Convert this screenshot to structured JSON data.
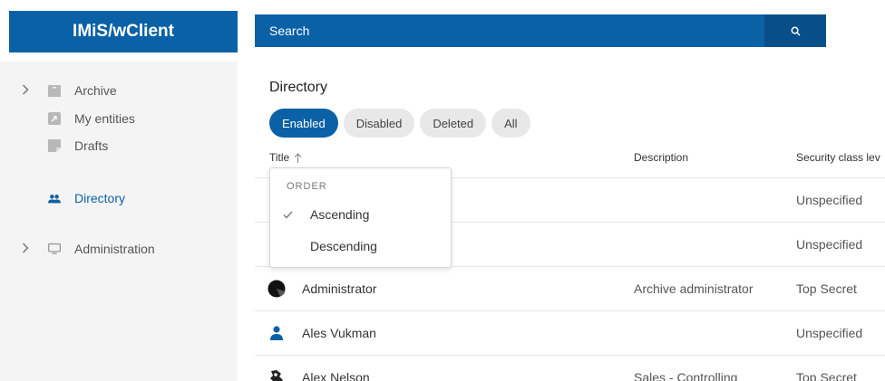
{
  "app": {
    "title": "IMiS/wClient"
  },
  "search": {
    "placeholder": "Search",
    "icon": "search-icon"
  },
  "sidebar": {
    "items": [
      {
        "label": "Archive",
        "icon": "archive-icon",
        "expandable": true
      },
      {
        "label": "My entities",
        "icon": "my-entities-icon",
        "expandable": false
      },
      {
        "label": "Drafts",
        "icon": "drafts-icon",
        "expandable": false
      },
      {
        "label": "Directory",
        "icon": "people-icon",
        "expandable": false,
        "active": true
      },
      {
        "label": "Administration",
        "icon": "monitor-icon",
        "expandable": true
      }
    ]
  },
  "main": {
    "title": "Directory",
    "filters": [
      {
        "label": "Enabled",
        "active": true
      },
      {
        "label": "Disabled",
        "active": false
      },
      {
        "label": "Deleted",
        "active": false
      },
      {
        "label": "All",
        "active": false
      }
    ],
    "columns": {
      "title": "Title",
      "description": "Description",
      "security": "Security class lev"
    },
    "rows": [
      {
        "name": "",
        "description": "",
        "security": "Unspecified"
      },
      {
        "name": "",
        "description": "",
        "security": "Unspecified"
      },
      {
        "name": "Administrator",
        "description": "Archive administrator",
        "security": "Top Secret"
      },
      {
        "name": "Ales Vukman",
        "description": "",
        "security": "Unspecified"
      },
      {
        "name": "Alex Nelson",
        "description": "Sales - Controlling",
        "security": "Top Secret"
      }
    ]
  },
  "order_menu": {
    "heading": "ORDER",
    "options": [
      {
        "label": "Ascending",
        "selected": true
      },
      {
        "label": "Descending",
        "selected": false
      }
    ]
  },
  "colors": {
    "brand": "#0a61a6",
    "sidebar_bg": "#f4f4f4",
    "chip_bg": "#e8e8e8"
  }
}
